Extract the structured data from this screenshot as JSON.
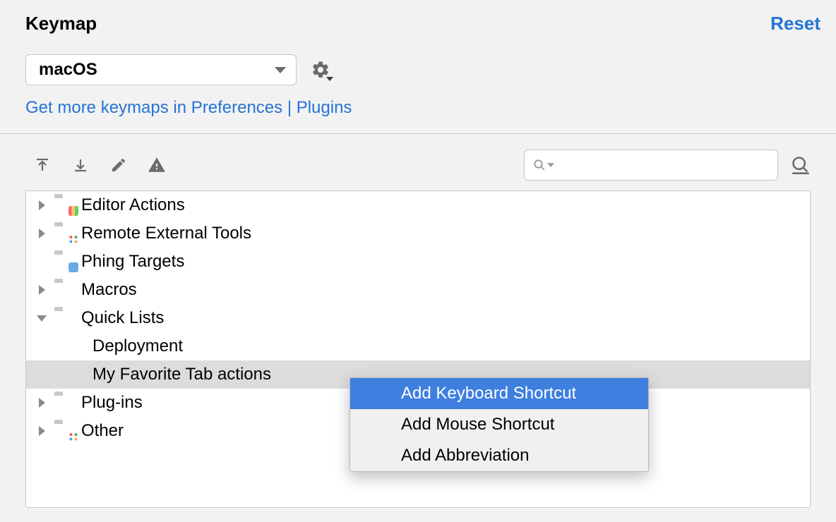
{
  "header": {
    "title": "Keymap",
    "reset": "Reset"
  },
  "keymap_dropdown": {
    "selected": "macOS"
  },
  "link": "Get more keymaps in Preferences | Plugins",
  "search": {
    "placeholder": ""
  },
  "tree": {
    "items": [
      {
        "label": "Editor Actions",
        "expandable": true,
        "expanded": false,
        "icon": "chart"
      },
      {
        "label": "Remote External Tools",
        "expandable": true,
        "expanded": false,
        "icon": "dots"
      },
      {
        "label": "Phing Targets",
        "expandable": false,
        "expanded": false,
        "icon": "gear"
      },
      {
        "label": "Macros",
        "expandable": true,
        "expanded": false,
        "icon": "plain"
      },
      {
        "label": "Quick Lists",
        "expandable": true,
        "expanded": true,
        "icon": "plain",
        "children": [
          {
            "label": "Deployment",
            "selected": false
          },
          {
            "label": "My Favorite Tab actions",
            "selected": true
          }
        ]
      },
      {
        "label": "Plug-ins",
        "expandable": true,
        "expanded": false,
        "icon": "plain"
      },
      {
        "label": "Other",
        "expandable": true,
        "expanded": false,
        "icon": "dots"
      }
    ]
  },
  "context_menu": {
    "items": [
      {
        "label": "Add Keyboard Shortcut",
        "highlight": true
      },
      {
        "label": "Add Mouse Shortcut",
        "highlight": false
      },
      {
        "label": "Add Abbreviation",
        "highlight": false
      }
    ]
  }
}
